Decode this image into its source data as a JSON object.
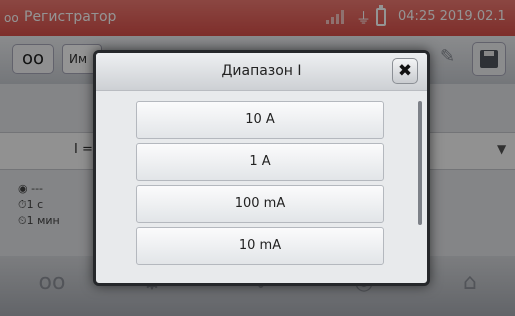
{
  "status_bar": {
    "app_title": "Регистратор",
    "datetime": "04:25 2019.02.1",
    "icons": [
      "cassette-icon",
      "signal-icon",
      "plug-icon",
      "battery-icon"
    ]
  },
  "toolbar": {
    "name_field_value": "Им",
    "icons": [
      "cassette-icon",
      "pencil-icon",
      "save-icon"
    ]
  },
  "background": {
    "row_label": "I =",
    "info": [
      "◉ ---",
      "⏱1 с",
      "⏲1 мин"
    ]
  },
  "bottom_nav": {
    "icons": [
      "cassette-icon",
      "settings-icon",
      "waveform-icon",
      "phase-icon",
      "home-icon"
    ]
  },
  "dialog": {
    "title": "Диапазон I",
    "close_symbol": "✖",
    "options": [
      {
        "label": "10 A"
      },
      {
        "label": "1 A"
      },
      {
        "label": "100 mA"
      },
      {
        "label": "10 mA"
      }
    ]
  },
  "colors": {
    "status_bar": "#e0615a",
    "dialog_border": "#26282b",
    "toolbar": "#dde0e4"
  }
}
